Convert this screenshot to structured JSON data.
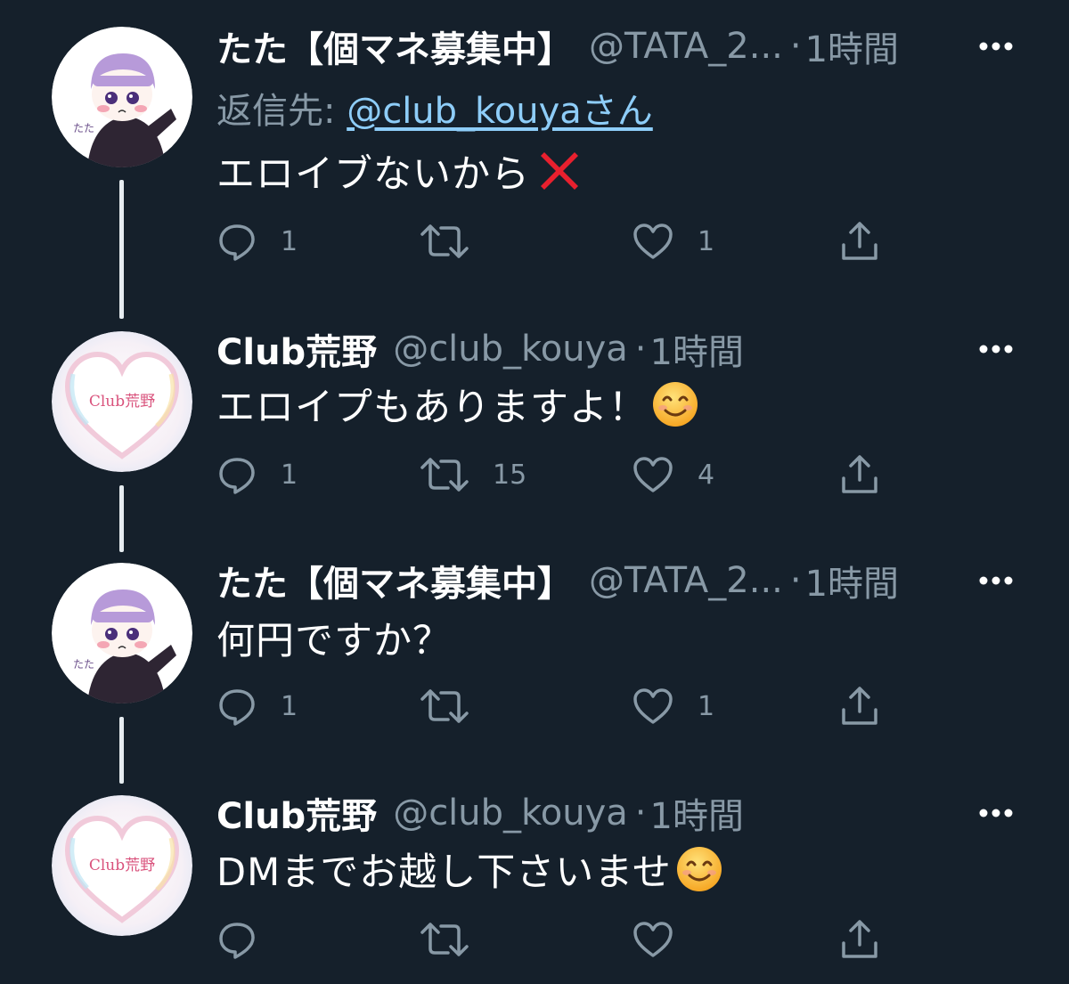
{
  "tweets": [
    {
      "name": "たた【個マネ募集中】",
      "handle": "@TATA_2...",
      "dot": "·",
      "time": "1時間",
      "reply_prefix": "返信先: ",
      "reply_link": "@club_kouyaさん",
      "text": "エロイブないから",
      "emoji": "cross-mark",
      "avatar_label": "たた",
      "counts": {
        "reply": "1",
        "retweet": "",
        "like": "1"
      }
    },
    {
      "name": "Club荒野",
      "handle": "@club_kouya",
      "dot": "·",
      "time": "1時間",
      "text": "エロイプもありますよ！",
      "emoji": "smiling-face",
      "avatar_label": "Club荒野",
      "counts": {
        "reply": "1",
        "retweet": "15",
        "like": "4"
      }
    },
    {
      "name": "たた【個マネ募集中】",
      "handle": "@TATA_2...",
      "dot": "·",
      "time": "1時間",
      "text": "何円ですか？",
      "emoji": "",
      "avatar_label": "たた",
      "counts": {
        "reply": "1",
        "retweet": "",
        "like": "1"
      }
    },
    {
      "name": "Club荒野",
      "handle": "@club_kouya",
      "dot": "·",
      "time": "1時間",
      "text": "DMまでお越し下さいませ",
      "emoji": "smiling-face",
      "avatar_label": "Club荒野",
      "counts": {
        "reply": "",
        "retweet": "",
        "like": ""
      }
    }
  ],
  "colors": {
    "background": "#15202b",
    "secondary_text": "#8899a6",
    "link": "#8ecdf8",
    "thread_line": "#e6ecf0"
  }
}
